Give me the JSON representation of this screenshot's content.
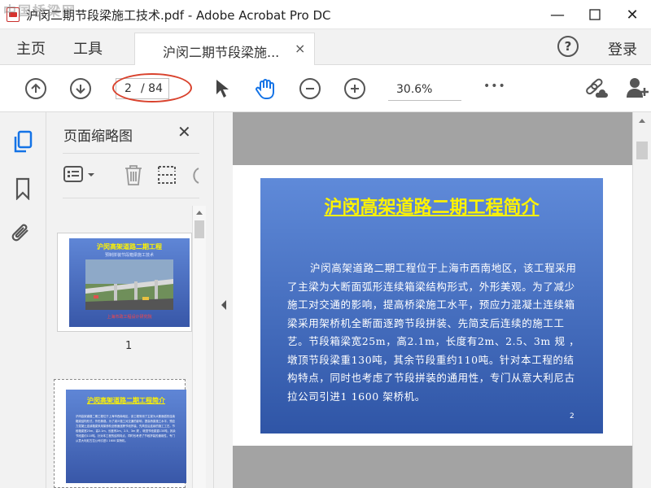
{
  "window": {
    "title": "沪闵二期节段梁施工技术.pdf - Adobe Acrobat Pro DC",
    "minimize": "—",
    "maximize": "☐",
    "close": "✕"
  },
  "watermark": "中国桥梁网",
  "tabs": {
    "home": "主页",
    "tools": "工具",
    "document": "沪闵二期节段梁施...",
    "document_close": "×",
    "help": "?",
    "login": "登录"
  },
  "toolbar": {
    "page_current": "2",
    "page_total": "/ 84",
    "zoom": "30.6%",
    "more": "•••"
  },
  "thumbnails": {
    "title": "页面缩略图",
    "close": "✕",
    "pages": [
      {
        "number": "1",
        "slide_title": "沪闵高架道路二期工程",
        "slide_subtitle": "预制拼装节段箱梁施工技术",
        "slide_footer": "上海市政工程设计研究院"
      },
      {
        "number": "2",
        "slide_title": "沪闵高架道路二期工程简介",
        "slide_text": "沪闵高架道路二期工程位于上海市西南地区，该工程采用了主梁为大断面弧形连续箱梁结构形式，外形美观。为了减少施工对交通的影响，提高桥梁施工水平，预应力混凝土连续箱梁采用架桥机全断面逐跨节段拼装、先简支后连续的施工工艺。节段箱梁宽25m，高2.1m，长度有2m、2.5、3m 规 ，墩顶节段梁重130吨，其余节段重约110吨。针对本工程的结构特点，同时也考虑了节段拼装的通用性，专门从意大利尼古拉公司引进1 1600 架桥机。"
      }
    ]
  },
  "main_page": {
    "slide_title": "沪闵高架道路二期工程简介",
    "paragraph": "沪闵高架道路二期工程位于上海市西南地区，该工程采用了主梁为大断面弧形连续箱梁结构形式，外形美观。为了减少施工对交通的影响，提高桥梁施工水平，预应力混凝土连续箱梁采用架桥机全断面逐跨节段拼装、先简支后连续的施工工艺。节段箱梁宽25m，高2.1m，长度有2m、2.5、3m    规   ，墩顶节段梁重130吨，其余节段重约110吨。针对本工程的结构特点，同时也考虑了节段拼装的通用性，专门从意大利尼古拉公司引进1   1600  架桥机。",
    "page_number": "2"
  },
  "colors": {
    "slide_top": "#5f8ad9",
    "slide_bottom": "#2f55a6",
    "title_yellow": "#fff300",
    "annotation_red": "#d9422d",
    "hand_tool_blue": "#1473e6"
  }
}
